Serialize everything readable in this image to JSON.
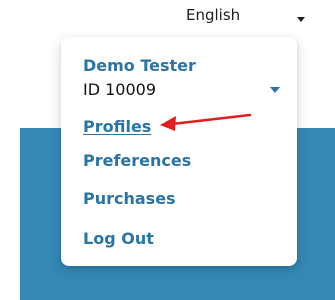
{
  "header": {
    "language_label": "English"
  },
  "user_menu": {
    "name": "Demo Tester",
    "id_label": "ID 10009",
    "items": [
      {
        "label": "Profiles"
      },
      {
        "label": "Preferences"
      },
      {
        "label": "Purchases"
      },
      {
        "label": "Log Out"
      }
    ]
  },
  "colors": {
    "link": "#2a74a6",
    "background_band": "#3589b7",
    "annotation_arrow": "#e02020"
  },
  "icons": {
    "language_dropdown": "chevron-down-icon",
    "user_dropdown": "chevron-down-icon",
    "annotation": "red-arrow-icon"
  }
}
